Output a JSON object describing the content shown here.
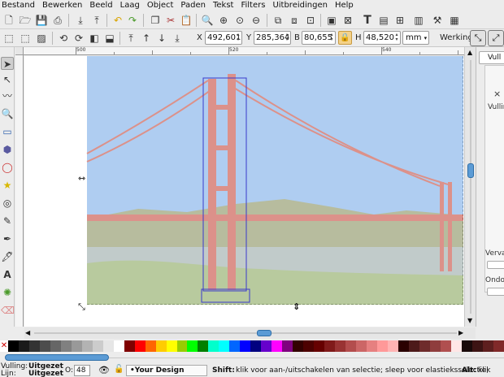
{
  "menubar": [
    "Bestand",
    "Bewerken",
    "Beeld",
    "Laag",
    "Object",
    "Paden",
    "Tekst",
    "Filters",
    "Uitbreidingen",
    "Help"
  ],
  "coords": {
    "x_label": "X",
    "x_value": "492,601",
    "y_label": "Y",
    "y_value": "285,364",
    "b_label": "B",
    "b_value": "80,655",
    "h_label": "H",
    "h_value": "48,520",
    "unit": "mm",
    "werking_label": "Werking:"
  },
  "ruler": {
    "top": [
      "500",
      "520",
      "540"
    ]
  },
  "panel": {
    "tab": "Vull",
    "x": "×",
    "vulling": "Vullin",
    "vervagen": "Verva",
    "ondoorzichtigheid": "Ondo"
  },
  "palette_colors": [
    "#000000",
    "#1a1a1a",
    "#333333",
    "#4d4d4d",
    "#666666",
    "#808080",
    "#999999",
    "#b3b3b3",
    "#cccccc",
    "#e6e6e6",
    "#ffffff",
    "#800000",
    "#ff0000",
    "#ff6600",
    "#ffcc00",
    "#ffff00",
    "#99cc00",
    "#00ff00",
    "#008000",
    "#00ffcc",
    "#00ffff",
    "#0066ff",
    "#0000ff",
    "#000080",
    "#6600cc",
    "#ff00ff",
    "#800080",
    "#330000",
    "#4d0000",
    "#660000",
    "#801a1a",
    "#993333",
    "#b34d4d",
    "#cc6666",
    "#e68080",
    "#ff9999",
    "#ffb3b3",
    "#2a0000",
    "#4d1a1a",
    "#6e2b2b",
    "#8f3d3d",
    "#b04f4f",
    "#ffe6e6",
    "#1a0a0a",
    "#3d1414",
    "#5e1f1f",
    "#802929"
  ],
  "status": {
    "vulling_label": "Vulling:",
    "lijn_label": "Lijn:",
    "vulling_value": "Uitgezet",
    "lijn_value": "Uitgezet",
    "opacity_label": "O:",
    "opacity_value": "48",
    "layer": "•Your Design",
    "shift_key": "Shift:",
    "hint": "klik voor aan-/uitschakelen van selectie; sleep voor elastieksselectie;",
    "alt_key": "Alt:",
    "hint2": "klik"
  }
}
